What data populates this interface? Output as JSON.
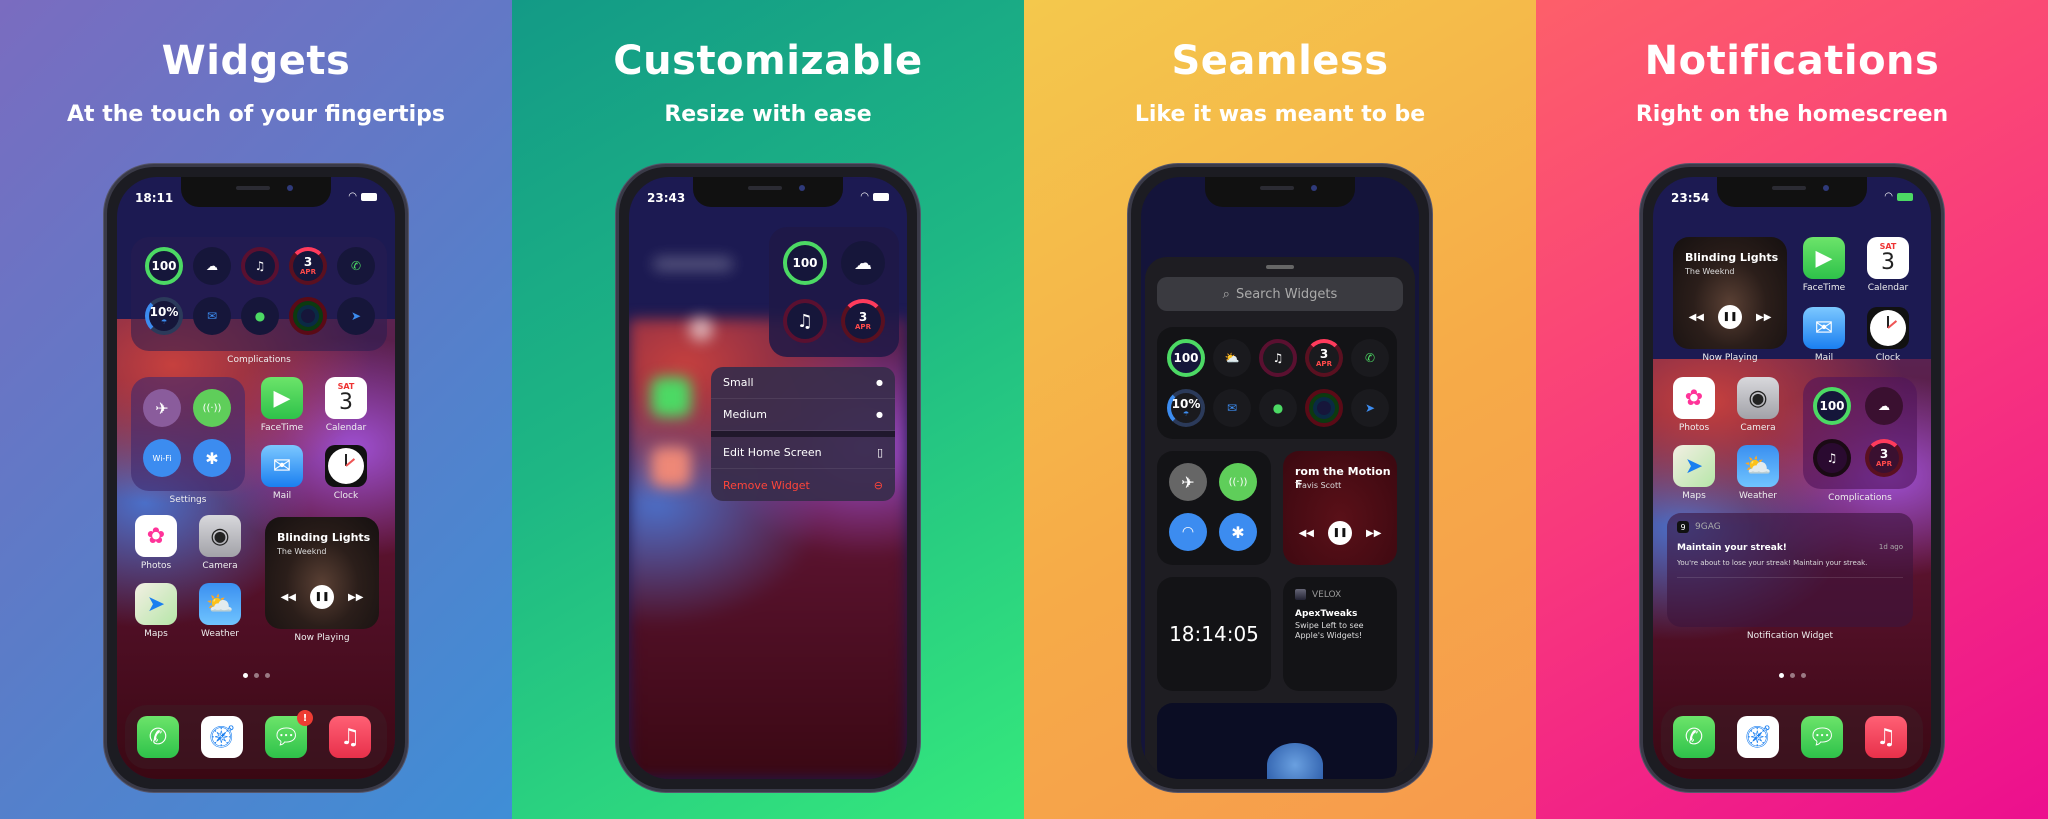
{
  "panels": [
    {
      "title": "Widgets",
      "subtitle": "At the touch of your fingertips",
      "status_time": "18:11",
      "complications": {
        "label": "Complications",
        "items": [
          {
            "icon": "battery-ring",
            "text": "100"
          },
          {
            "icon": "cloud-icon",
            "text": "☁"
          },
          {
            "icon": "music-icon",
            "text": "♫"
          },
          {
            "icon": "calendar-ring",
            "text": "3",
            "sub": "APR"
          },
          {
            "icon": "phone-icon",
            "text": "✆"
          },
          {
            "icon": "rain-ring",
            "text": "10%",
            "sub": "☂"
          },
          {
            "icon": "mail-icon",
            "text": "✉"
          },
          {
            "icon": "messages-icon",
            "text": "●"
          },
          {
            "icon": "activity-rings",
            "text": ""
          },
          {
            "icon": "location-arrow-icon",
            "text": "➤"
          }
        ]
      },
      "settings_widget": {
        "label": "Settings",
        "toggles": [
          "✈",
          "((·))",
          "Wi-Fi",
          "✱"
        ]
      },
      "apps": [
        {
          "name": "FaceTime"
        },
        {
          "name": "Calendar",
          "day": "SAT",
          "date": "3"
        },
        {
          "name": "Mail"
        },
        {
          "name": "Clock"
        },
        {
          "name": "Photos"
        },
        {
          "name": "Camera"
        },
        {
          "name": "Maps"
        },
        {
          "name": "Weather"
        }
      ],
      "now_playing": {
        "label": "Now Playing",
        "title": "Blinding Lights",
        "artist": "The Weeknd"
      },
      "page_dots": 3,
      "dock": [
        {
          "name": "Phone"
        },
        {
          "name": "Safari"
        },
        {
          "name": "Messages",
          "badge": "!"
        },
        {
          "name": "Music"
        }
      ]
    },
    {
      "title": "Customizable",
      "subtitle": "Resize with ease",
      "status_time": "23:43",
      "complications": [
        {
          "text": "100"
        },
        {
          "text": "☁"
        },
        {
          "text": "♫"
        },
        {
          "text": "3",
          "sub": "APR"
        }
      ],
      "menu": {
        "items": [
          {
            "label": "Small",
            "icon": "●"
          },
          {
            "label": "Medium",
            "icon": "●"
          },
          {
            "label": "Edit Home Screen",
            "icon": "▯"
          },
          {
            "label": "Remove Widget",
            "icon": "⊖",
            "destructive": true
          }
        ]
      }
    },
    {
      "title": "Seamless",
      "subtitle": "Like it was meant to be",
      "search_placeholder": "Search Widgets",
      "complications": [
        {
          "text": "100"
        },
        {
          "text": "⛅"
        },
        {
          "text": "♫"
        },
        {
          "text": "3",
          "sub": "APR"
        },
        {
          "text": "✆"
        },
        {
          "text": "10%",
          "sub": "☂"
        },
        {
          "text": "✉"
        },
        {
          "text": "●"
        },
        {
          "text": ""
        },
        {
          "text": "➤"
        }
      ],
      "now_playing": {
        "title": "rom the Motion F",
        "artist": "Travis Scott"
      },
      "clock_time": "18:14:05",
      "velox": {
        "app": "VELOX",
        "title": "ApexTweaks",
        "body": "Swipe Left to see Apple's Widgets!"
      }
    },
    {
      "title": "Notifications",
      "subtitle": "Right on the homescreen",
      "status_time": "23:54",
      "now_playing": {
        "label": "Now Playing",
        "title": "Blinding Lights",
        "artist": "The Weeknd"
      },
      "apps": [
        {
          "name": "FaceTime"
        },
        {
          "name": "Calendar",
          "day": "SAT",
          "date": "3"
        },
        {
          "name": "Mail"
        },
        {
          "name": "Clock"
        },
        {
          "name": "Photos"
        },
        {
          "name": "Camera"
        },
        {
          "name": "Maps"
        },
        {
          "name": "Weather"
        }
      ],
      "complications": {
        "label": "Complications",
        "items": [
          {
            "text": "100"
          },
          {
            "text": "☁"
          },
          {
            "text": "♫"
          },
          {
            "text": "3",
            "sub": "APR"
          }
        ]
      },
      "notification": {
        "label": "Notification Widget",
        "app": "9GAG",
        "title": "Maintain your streak!",
        "time": "1d ago",
        "body": "You're about to lose your streak! Maintain your streak."
      },
      "dock": [
        {
          "name": "Phone"
        },
        {
          "name": "Safari"
        },
        {
          "name": "Messages"
        },
        {
          "name": "Music"
        }
      ]
    }
  ]
}
